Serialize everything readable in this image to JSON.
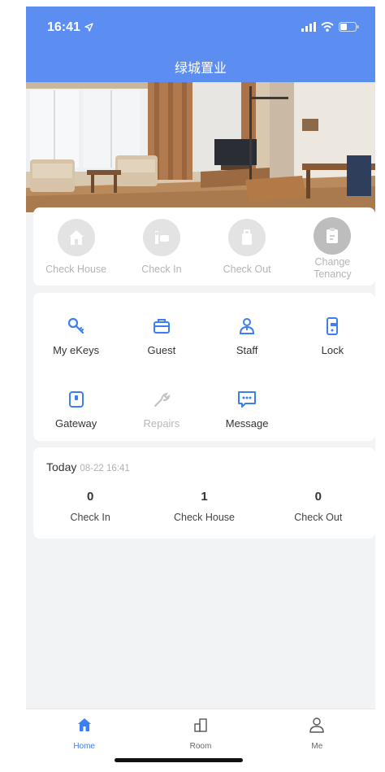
{
  "status_bar": {
    "time": "16:41"
  },
  "header": {
    "title": "绿城置业"
  },
  "quick_actions": [
    {
      "label": "Check House",
      "icon": "house-icon"
    },
    {
      "label": "Check In",
      "icon": "check-in-icon"
    },
    {
      "label": "Check Out",
      "icon": "luggage-icon"
    },
    {
      "label": "Change\nTenancy",
      "icon": "change-tenancy-icon"
    }
  ],
  "functions": {
    "row1": [
      {
        "label": "My eKeys",
        "icon": "key-icon"
      },
      {
        "label": "Guest",
        "icon": "guest-card-icon"
      },
      {
        "label": "Staff",
        "icon": "staff-icon"
      },
      {
        "label": "Lock",
        "icon": "lock-icon"
      }
    ],
    "row2": [
      {
        "label": "Gateway",
        "icon": "gateway-icon"
      },
      {
        "label": "Repairs",
        "icon": "wrench-icon"
      },
      {
        "label": "Message",
        "icon": "message-icon"
      }
    ]
  },
  "today": {
    "title": "Today",
    "datetime": "08-22 16:41",
    "stats": [
      {
        "value": "0",
        "label": "Check In"
      },
      {
        "value": "1",
        "label": "Check House"
      },
      {
        "value": "0",
        "label": "Check Out"
      }
    ]
  },
  "tabbar": [
    {
      "label": "Home",
      "icon": "home-icon",
      "active": true
    },
    {
      "label": "Room",
      "icon": "room-icon",
      "active": false
    },
    {
      "label": "Me",
      "icon": "person-icon",
      "active": false
    }
  ],
  "colors": {
    "primary": "#5b8ef0",
    "accent": "#3d7ff0",
    "background": "#f2f3f5"
  }
}
